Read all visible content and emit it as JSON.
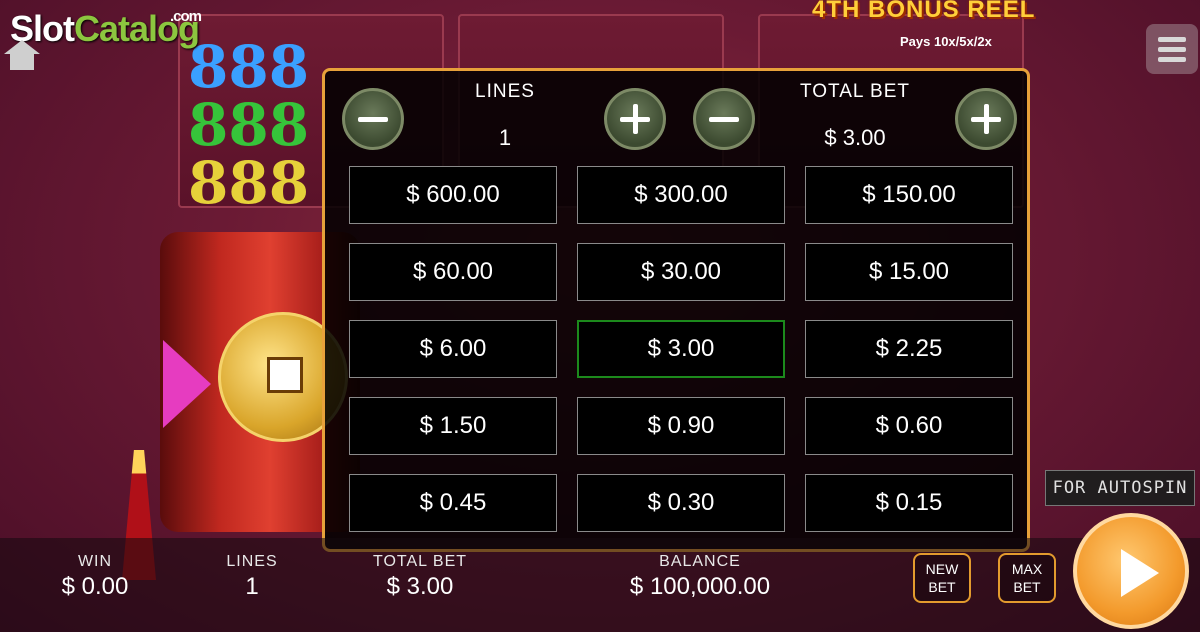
{
  "logo": {
    "part1": "Slot",
    "part2": "Catalog",
    "suffix": ".com"
  },
  "bonus": {
    "title": "4TH BONUS REEL",
    "pays": "Pays 10x/5x/2x"
  },
  "bet_panel": {
    "lines_label": "LINES",
    "lines_value": "1",
    "total_bet_label": "TOTAL BET",
    "total_bet_value": "$ 3.00",
    "options": [
      [
        "$ 600.00",
        "$ 300.00",
        "$ 150.00"
      ],
      [
        "$ 60.00",
        "$ 30.00",
        "$ 15.00"
      ],
      [
        "$ 6.00",
        "$ 3.00",
        "$ 2.25"
      ],
      [
        "$ 1.50",
        "$ 0.90",
        "$ 0.60"
      ],
      [
        "$ 0.45",
        "$ 0.30",
        "$ 0.15"
      ]
    ],
    "selected": "$ 3.00"
  },
  "bottom": {
    "win_label": "WIN",
    "win_value": "$ 0.00",
    "lines_label": "LINES",
    "lines_value": "1",
    "total_bet_label": "TOTAL BET",
    "total_bet_value": "$ 3.00",
    "balance_label": "BALANCE",
    "balance_value": "$ 100,000.00",
    "new_bet_line1": "NEW",
    "new_bet_line2": "BET",
    "max_bet_line1": "MAX",
    "max_bet_line2": "BET"
  },
  "autospin_tip": "FOR AUTOSPIN",
  "colors": {
    "accent": "#e7a13a",
    "selected": "#1c8a1c",
    "spin": "#f39a2c"
  }
}
